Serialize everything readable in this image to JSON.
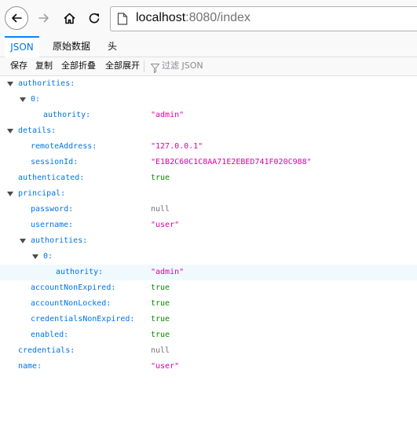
{
  "browser": {
    "url_host": "localhost",
    "url_rest": ":8080/index",
    "back_icon": "back-arrow-icon",
    "forward_icon": "forward-arrow-icon",
    "home_icon": "home-icon",
    "reload_icon": "reload-icon",
    "page_icon": "page-icon"
  },
  "tabs": [
    {
      "label": "JSON",
      "selected": true
    },
    {
      "label": "原始数据",
      "selected": false
    },
    {
      "label": "头",
      "selected": false
    }
  ],
  "toolbar": {
    "save": "保存",
    "copy": "复制",
    "collapse_all": "全部折叠",
    "expand_all": "全部展开",
    "filter_placeholder": "过滤 JSON"
  },
  "colors": {
    "key": "#0074e8",
    "string": "#dd00a9",
    "boolean": "#058b00",
    "null": "#737373",
    "tab_selected": "#0a84ff"
  },
  "json_rows": [
    {
      "key": "authorities:",
      "value": "",
      "type": "",
      "depth": 0,
      "expandable": true
    },
    {
      "key": "0:",
      "value": "",
      "type": "",
      "depth": 1,
      "expandable": true
    },
    {
      "key": "authority:",
      "value": "\"admin\"",
      "type": "string",
      "depth": 2,
      "expandable": false
    },
    {
      "key": "details:",
      "value": "",
      "type": "",
      "depth": 0,
      "expandable": true
    },
    {
      "key": "remoteAddress:",
      "value": "\"127.0.0.1\"",
      "type": "string",
      "depth": 1,
      "expandable": false
    },
    {
      "key": "sessionId:",
      "value": "\"E1B2C60C1C8AA71E2EBED741F020C988\"",
      "type": "string",
      "depth": 1,
      "expandable": false
    },
    {
      "key": "authenticated:",
      "value": "true",
      "type": "boolean",
      "depth": 0,
      "expandable": false
    },
    {
      "key": "principal:",
      "value": "",
      "type": "",
      "depth": 0,
      "expandable": true
    },
    {
      "key": "password:",
      "value": "null",
      "type": "null",
      "depth": 1,
      "expandable": false
    },
    {
      "key": "username:",
      "value": "\"user\"",
      "type": "string",
      "depth": 1,
      "expandable": false
    },
    {
      "key": "authorities:",
      "value": "",
      "type": "",
      "depth": 1,
      "expandable": true
    },
    {
      "key": "0:",
      "value": "",
      "type": "",
      "depth": 2,
      "expandable": true
    },
    {
      "key": "authority:",
      "value": "\"admin\"",
      "type": "string",
      "depth": 3,
      "expandable": false,
      "highlighted": true
    },
    {
      "key": "accountNonExpired:",
      "value": "true",
      "type": "boolean",
      "depth": 1,
      "expandable": false
    },
    {
      "key": "accountNonLocked:",
      "value": "true",
      "type": "boolean",
      "depth": 1,
      "expandable": false
    },
    {
      "key": "credentialsNonExpired:",
      "value": "true",
      "type": "boolean",
      "depth": 1,
      "expandable": false
    },
    {
      "key": "enabled:",
      "value": "true",
      "type": "boolean",
      "depth": 1,
      "expandable": false
    },
    {
      "key": "credentials:",
      "value": "null",
      "type": "null",
      "depth": 0,
      "expandable": false
    },
    {
      "key": "name:",
      "value": "\"user\"",
      "type": "string",
      "depth": 0,
      "expandable": false
    }
  ]
}
